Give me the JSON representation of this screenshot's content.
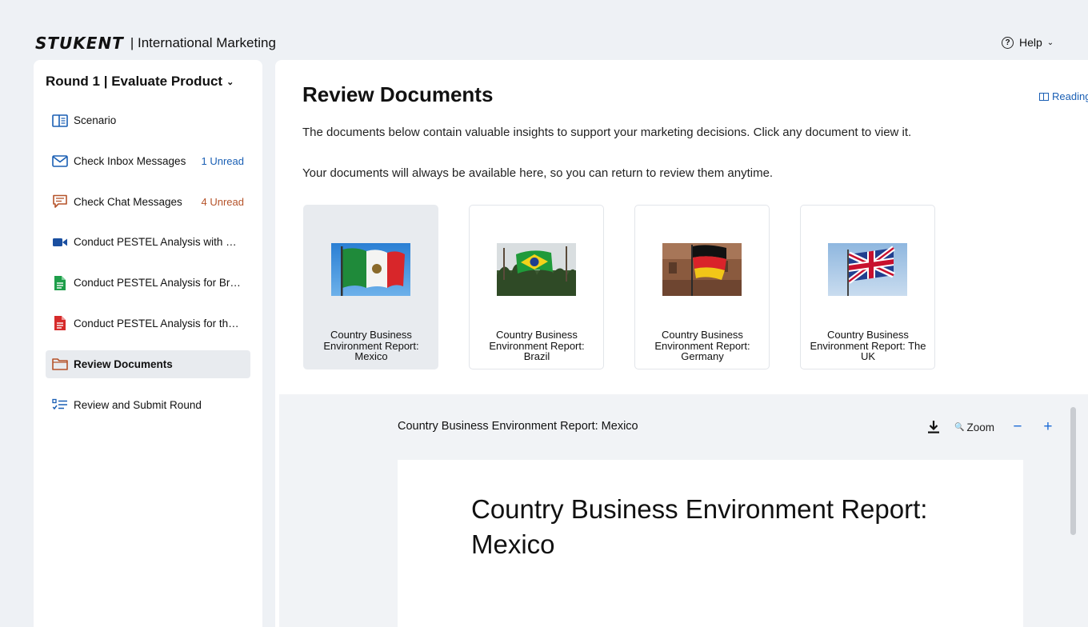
{
  "header": {
    "logo_text": "STUKENT",
    "app_title": "| International Marketing",
    "help_label": "Help",
    "help_icon": "?"
  },
  "sidebar": {
    "round_title": "Round 1 | Evaluate Product",
    "items": [
      {
        "label": "Scenario",
        "icon": "book-open-icon",
        "badge": ""
      },
      {
        "label": "Check Inbox Messages",
        "icon": "envelope-icon",
        "badge": "1 Unread",
        "badge_color": "#1a5fb4"
      },
      {
        "label": "Check Chat Messages",
        "icon": "chat-icon",
        "badge": "4 Unread",
        "badge_color": "#b5532a"
      },
      {
        "label": "Conduct PESTEL Analysis with Ma...",
        "icon": "video-camera-icon",
        "badge": ""
      },
      {
        "label": "Conduct PESTEL Analysis for Brazil",
        "icon": "green-document-icon",
        "badge": ""
      },
      {
        "label": "Conduct PESTEL Analysis for the ...",
        "icon": "red-document-icon",
        "badge": ""
      },
      {
        "label": "Review Documents",
        "icon": "folder-icon",
        "badge": "",
        "active": true
      },
      {
        "label": "Review and Submit Round",
        "icon": "checklist-icon",
        "badge": ""
      }
    ]
  },
  "main": {
    "title": "Review Documents",
    "reading_label": "Reading",
    "description_1": "The documents below contain valuable insights to support your marketing decisions. Click any document to view it.",
    "description_2": "Your documents will always be available here, so you can return to review them anytime.",
    "documents": [
      {
        "title": "Country Business Environment Report: Mexico",
        "flag": "mexico-flag",
        "selected": true
      },
      {
        "title": "Country Business Environment Report: Brazil",
        "flag": "brazil-flag"
      },
      {
        "title": "Country Business Environment Report: Germany",
        "flag": "germany-flag"
      },
      {
        "title": "Country Business Environment Report: The UK",
        "flag": "uk-flag"
      }
    ]
  },
  "viewer": {
    "title": "Country Business Environment Report: Mexico",
    "zoom_label": "Zoom",
    "zoom_out": "−",
    "zoom_in": "+",
    "doc_heading": "Country Business Environment Report: Mexico"
  },
  "colors": {
    "accent_blue": "#1a5fb4",
    "unread_orange": "#b5532a",
    "active_bg": "#e8ebef",
    "page_bg": "#eef1f5"
  }
}
